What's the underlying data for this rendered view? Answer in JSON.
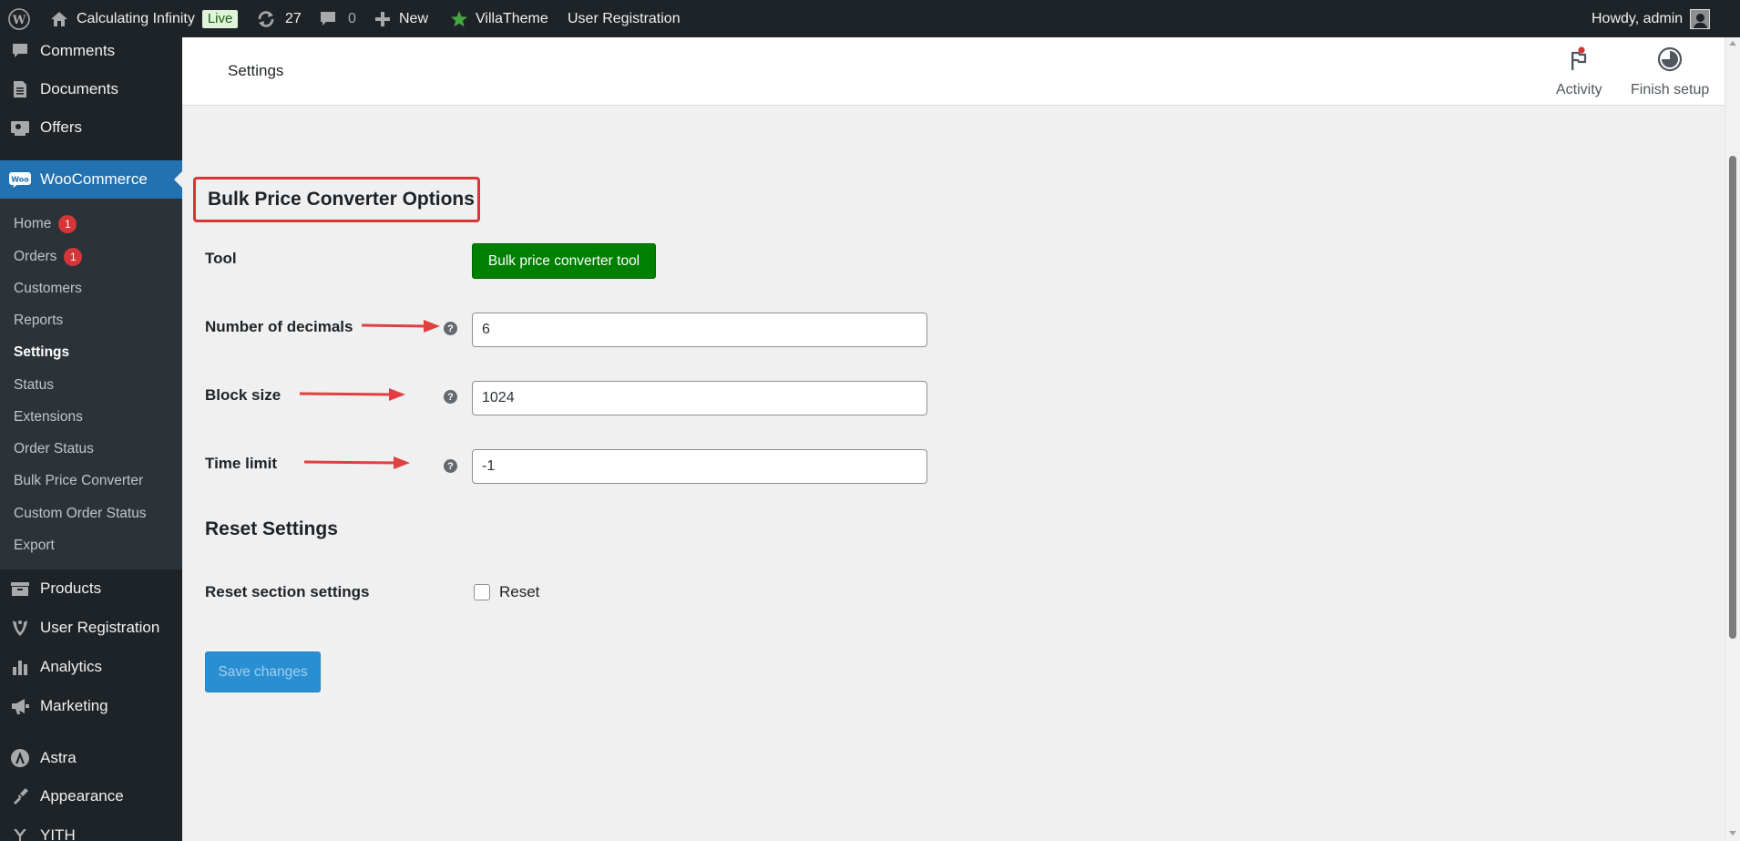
{
  "adminbar": {
    "site_name": "Calculating Infinity",
    "live_badge": "Live",
    "updates_count": "27",
    "comments_count": "0",
    "new_label": "New",
    "villatheme_label": "VillaTheme",
    "user_registration_label": "User Registration",
    "howdy": "Howdy, admin"
  },
  "sidebar": {
    "top_items": [
      {
        "label": "Comments",
        "icon": "comment-icon"
      },
      {
        "label": "Documents",
        "icon": "document-icon"
      },
      {
        "label": "Offers",
        "icon": "offers-icon"
      },
      {
        "label": "WooCommerce",
        "icon": "woocommerce-icon"
      }
    ],
    "submenu": [
      {
        "label": "Home",
        "badge": "1"
      },
      {
        "label": "Orders",
        "badge": "1"
      },
      {
        "label": "Customers"
      },
      {
        "label": "Reports"
      },
      {
        "label": "Settings"
      },
      {
        "label": "Status"
      },
      {
        "label": "Extensions"
      },
      {
        "label": "Order Status"
      },
      {
        "label": "Bulk Price Converter"
      },
      {
        "label": "Custom Order Status"
      },
      {
        "label": "Export"
      }
    ],
    "bottom_items": [
      {
        "label": "Products",
        "icon": "products-icon"
      },
      {
        "label": "User Registration",
        "icon": "user-registration-icon"
      },
      {
        "label": "Analytics",
        "icon": "analytics-icon"
      },
      {
        "label": "Marketing",
        "icon": "marketing-icon"
      },
      {
        "label": "Astra",
        "icon": "astra-icon"
      },
      {
        "label": "Appearance",
        "icon": "appearance-icon"
      },
      {
        "label": "YITH",
        "icon": "yith-icon"
      }
    ]
  },
  "header": {
    "title": "Settings",
    "activity_label": "Activity",
    "finish_setup_label": "Finish setup"
  },
  "main": {
    "section_title": "Bulk Price Converter Options",
    "tool_label": "Tool",
    "tool_button": "Bulk price converter tool",
    "decimals_label": "Number of decimals",
    "decimals_value": "6",
    "block_size_label": "Block size",
    "block_size_value": "1024",
    "time_limit_label": "Time limit",
    "time_limit_value": "-1",
    "help_glyph": "?",
    "reset_heading": "Reset Settings",
    "reset_label": "Reset section settings",
    "reset_checkbox_label": "Reset",
    "save_button": "Save changes"
  },
  "colors": {
    "adminbar_bg": "#1d2327",
    "active_menu": "#2271b1",
    "tool_button": "#008000",
    "highlight": "#d63638",
    "save_button": "#2a8fd1"
  }
}
